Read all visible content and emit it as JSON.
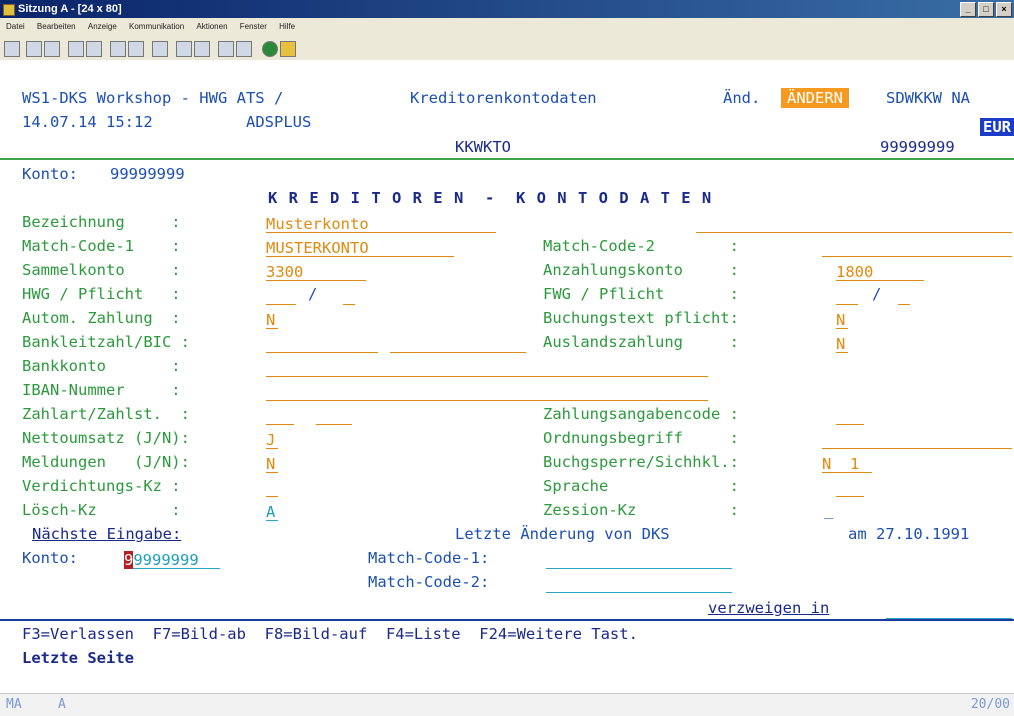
{
  "window": {
    "title": "Sitzung A - [24 x 80]",
    "buttons": [
      "_",
      "□",
      "×"
    ]
  },
  "menu": [
    "Datei",
    "Bearbeiten",
    "Anzeige",
    "Kommunikation",
    "Aktionen",
    "Fenster",
    "Hilfe"
  ],
  "toolbar_icons": [
    "print-icon",
    "copy-icon",
    "paste-icon",
    "send-icon",
    "receive-icon",
    "display-icon",
    "display2-icon",
    "record-icon",
    "macro-icon",
    "macro2-icon",
    "chart-icon",
    "chart2-icon",
    "globe-icon",
    "edit-icon"
  ],
  "header": {
    "app_title": "WS1-DKS Workshop - HWG ATS /",
    "screen_title": "Kreditorenkontodaten",
    "mode_label": "Änd.",
    "mode_badge": "ÄNDERN",
    "program": "SDWKKW NA",
    "datetime": "14.07.14 15:12",
    "user": "ADSPLUS",
    "currency": "EUR",
    "table_name": "KKWKTO",
    "account_right": "99999999"
  },
  "konto_line": {
    "label": "Konto:",
    "value": "99999999"
  },
  "heading": "K R E D I T O R E N  -  K O N T O D A T E N",
  "left_fields": [
    {
      "label": "Bezeichnung     :",
      "value": "Musterkonto"
    },
    {
      "label": "Match-Code-1    :",
      "value": "MUSTERKONTO"
    },
    {
      "label": "Sammelkonto     :",
      "value": "3300"
    },
    {
      "label": "HWG / Pflicht   :",
      "value": "/"
    },
    {
      "label": "Autom. Zahlung  :",
      "value": "N"
    },
    {
      "label": "Bankleitzahl/BIC :",
      "value": ""
    },
    {
      "label": "Bankkonto       :",
      "value": ""
    },
    {
      "label": "IBAN-Nummer     :",
      "value": ""
    },
    {
      "label": "Zahlart/Zahlst.  :",
      "value": ""
    },
    {
      "label": "Nettoumsatz (J/N):",
      "value": "J"
    },
    {
      "label": "Meldungen   (J/N):",
      "value": "N"
    },
    {
      "label": "Verdichtungs-Kz :",
      "value": ""
    },
    {
      "label": "Lösch-Kz        :",
      "value": "A"
    }
  ],
  "right_fields": [
    {
      "label": "Match-Code-2        :",
      "value": ""
    },
    {
      "label": "Anzahlungskonto     :",
      "value": "1800"
    },
    {
      "label": "FWG / Pflicht       :",
      "value": "/"
    },
    {
      "label": "Buchungstext pflicht:",
      "value": "N"
    },
    {
      "label": "Auslandszahlung     :",
      "value": "N"
    },
    {
      "label": "Zahlungsangabencode :",
      "value": ""
    },
    {
      "label": "Ordnungsbegriff     :",
      "value": ""
    },
    {
      "label": "Buchgsperre/Sichhkl.:",
      "value": "N  1"
    },
    {
      "label": "Sprache             :",
      "value": ""
    },
    {
      "label": "Zession-Kz          :",
      "value": "_"
    }
  ],
  "footer_info": {
    "next_input": "Nächste Eingabe:",
    "last_change": "Letzte Änderung von DKS",
    "date": "am 27.10.1991",
    "konto_label": "Konto:",
    "konto_cursor": "9",
    "konto_value": "9999999",
    "match1_label": "Match-Code-1:",
    "match2_label": "Match-Code-2:",
    "branch_label": "verzweigen in"
  },
  "function_keys": "F3=Verlassen  F7=Bild-ab  F8=Bild-auf  F4=Liste  F24=Weitere Tast.",
  "message": "Letzte Seite",
  "status_bar": {
    "left": "MA",
    "mid": "A",
    "right": "20/00"
  }
}
